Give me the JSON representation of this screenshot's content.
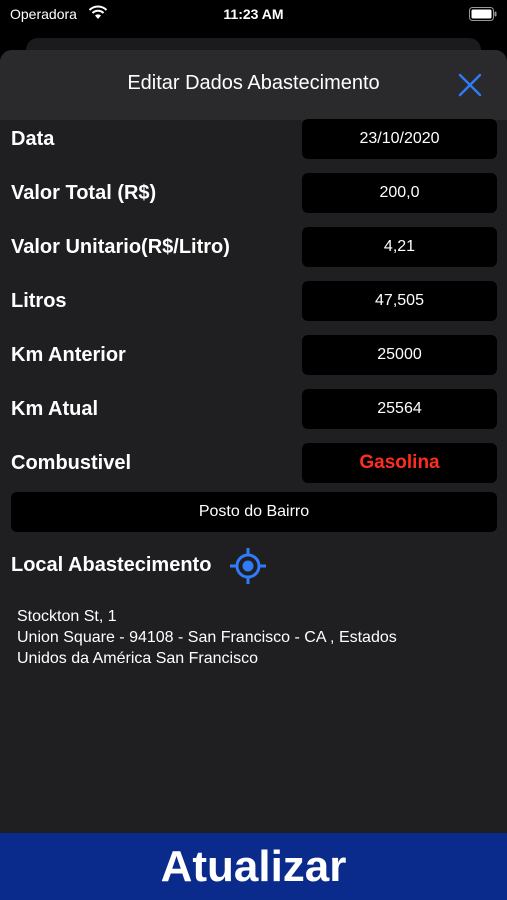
{
  "status_bar": {
    "carrier": "Operadora",
    "time": "11:23 AM"
  },
  "header": {
    "title": "Editar Dados Abastecimento",
    "close_icon": "close-icon"
  },
  "form": {
    "rows": [
      {
        "label": "Data",
        "value": "23/10/2020"
      },
      {
        "label": "Valor Total (R$)",
        "value": "200,0"
      },
      {
        "label": "Valor Unitario(R$/Litro)",
        "value": "4,21"
      },
      {
        "label": "Litros",
        "value": "47,505"
      },
      {
        "label": "Km Anterior",
        "value": "25000"
      },
      {
        "label": "Km Atual",
        "value": "25564"
      },
      {
        "label": "Combustivel",
        "value": "Gasolina"
      }
    ],
    "station": "Posto do Bairro"
  },
  "location": {
    "label": "Local Abastecimento",
    "icon": "locate-icon",
    "address_lines": [
      "Stockton St, 1",
      "Union Square -  94108 - San Francisco - CA , Estados",
      "Unidos da América San Francisco"
    ]
  },
  "actions": {
    "update_label": "Atualizar"
  },
  "colors": {
    "accent": "#2f7cf6",
    "fuel_text": "#ff2d20",
    "update_button": "#0a2a8c"
  }
}
